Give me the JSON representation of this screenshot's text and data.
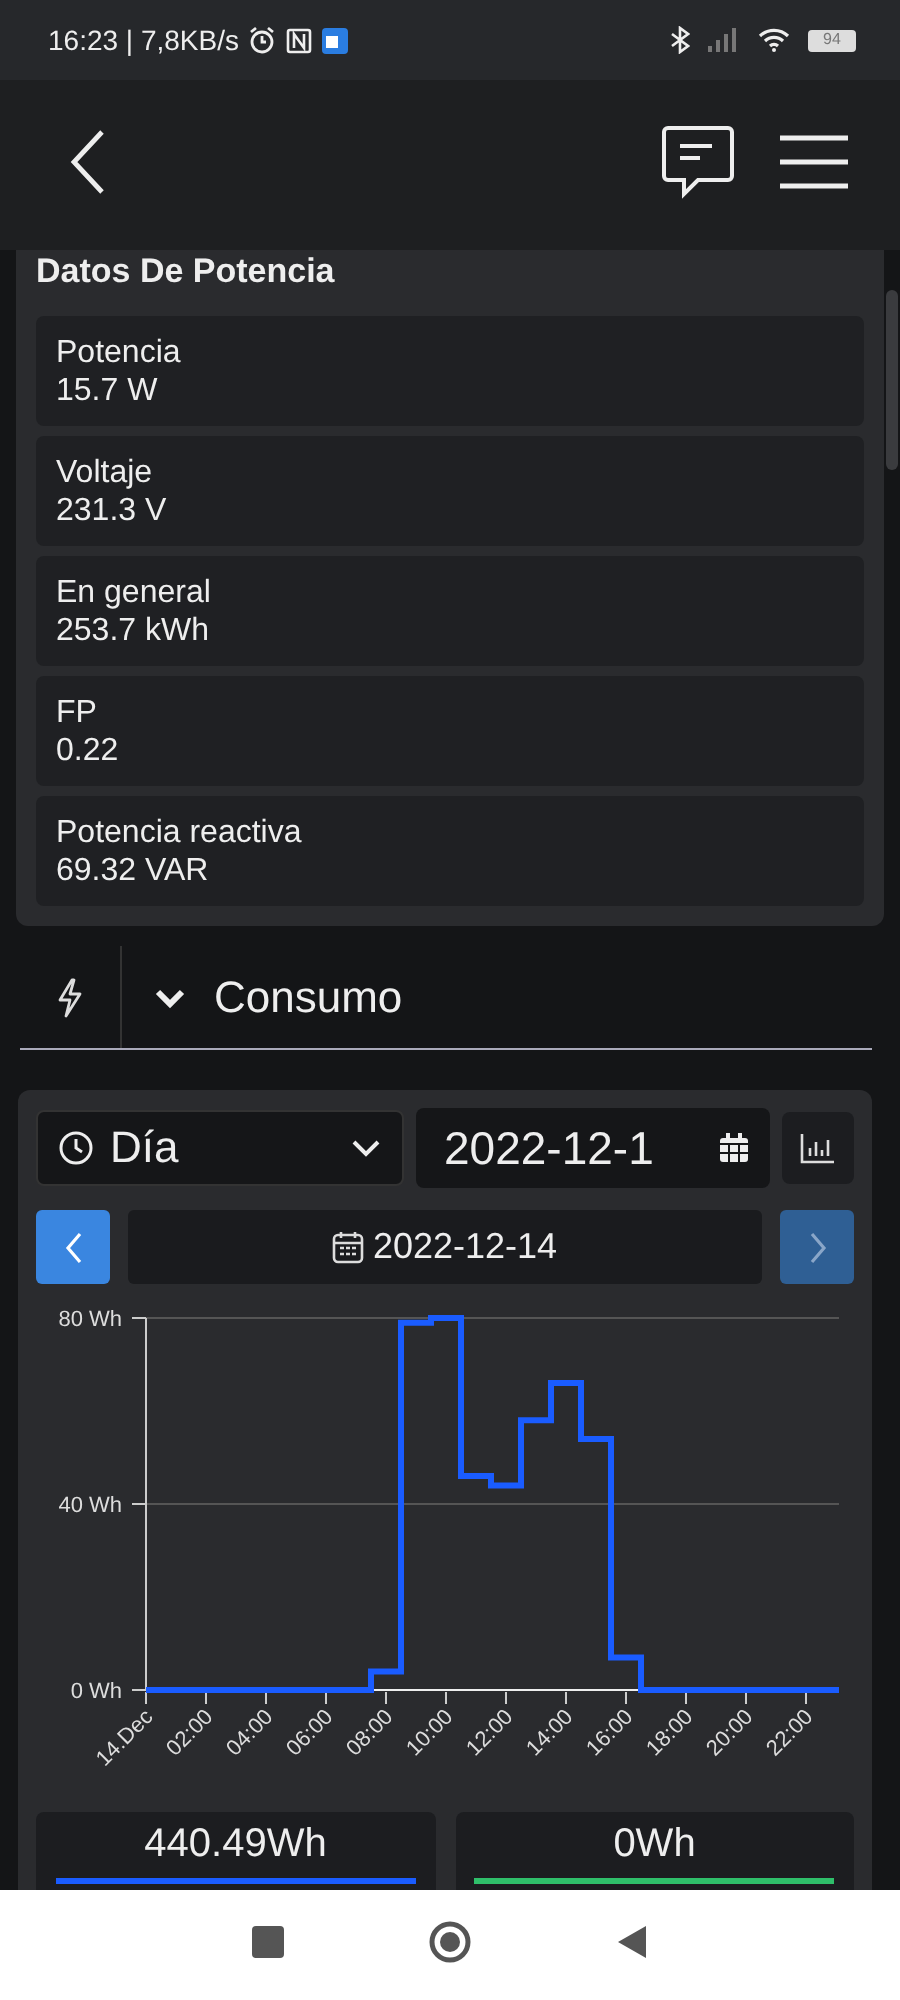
{
  "status_bar": {
    "time_speed": "16:23 | 7,8KB/s",
    "battery": "94"
  },
  "power_data": {
    "title": "Datos De Potencia",
    "items": [
      {
        "label": "Potencia",
        "value": "15.7 W"
      },
      {
        "label": "Voltaje",
        "value": "231.3 V"
      },
      {
        "label": "En general",
        "value": "253.7 kWh"
      },
      {
        "label": "FP",
        "value": "0.22"
      },
      {
        "label": "Potencia reactiva",
        "value": "69.32 VAR"
      }
    ]
  },
  "section": {
    "title": "Consumo",
    "expanded": true
  },
  "consumo": {
    "period": "Día",
    "date_field": "2022-12-1",
    "nav": {
      "prev_disabled": false,
      "date": "2022-12-14",
      "next_disabled": true
    },
    "chart_data": {
      "type": "line",
      "x": [
        0,
        7.5,
        7.5,
        8.5,
        8.5,
        9.5,
        9.5,
        10.5,
        10.5,
        11.5,
        11.5,
        12.5,
        12.5,
        13.5,
        13.5,
        14.5,
        14.5,
        15.5,
        15.5,
        16.5,
        16.5,
        23.1
      ],
      "series": [
        {
          "color": "#1a5cff",
          "values": [
            0,
            0,
            4,
            4,
            79,
            79,
            80,
            80,
            46,
            46,
            44,
            44,
            58,
            58,
            66,
            66,
            54,
            54,
            7,
            7,
            0,
            0
          ]
        }
      ],
      "xlim": [
        0,
        23.1
      ],
      "ylim": [
        0,
        80
      ],
      "yticks": [
        {
          "value": 0,
          "label": "0 Wh"
        },
        {
          "value": 40,
          "label": "40 Wh"
        },
        {
          "value": 80,
          "label": "80 Wh"
        }
      ],
      "xticks": [
        {
          "value": 0,
          "label": "14.Dec"
        },
        {
          "value": 2,
          "label": "02:00"
        },
        {
          "value": 4,
          "label": "04:00"
        },
        {
          "value": 6,
          "label": "06:00"
        },
        {
          "value": 8,
          "label": "08:00"
        },
        {
          "value": 10,
          "label": "10:00"
        },
        {
          "value": 12,
          "label": "12:00"
        },
        {
          "value": 14,
          "label": "14:00"
        },
        {
          "value": 16,
          "label": "16:00"
        },
        {
          "value": 18,
          "label": "18:00"
        },
        {
          "value": 20,
          "label": "20:00"
        },
        {
          "value": 22,
          "label": "22:00"
        }
      ]
    },
    "totals": [
      {
        "value": "440.49Wh",
        "color": "#1a5cff"
      },
      {
        "value": "0Wh",
        "color": "#2fbf6a"
      }
    ]
  }
}
